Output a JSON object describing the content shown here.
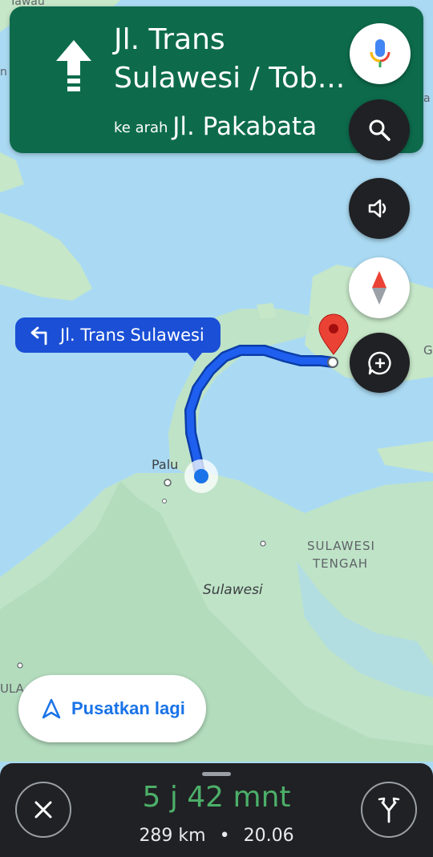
{
  "navigation": {
    "street": "Jl. Trans Sulawesi / Tob...",
    "toward_prefix": "ke arah",
    "toward_street": "Jl. Pakabata"
  },
  "route_label": "Jl. Trans Sulawesi",
  "map_labels": {
    "top_left": "Tawau",
    "city": "Palu",
    "region_line1": "SULAWESI",
    "region_line2": "TENGAH",
    "island": "Sulawesi",
    "edge_left": "ULA",
    "edge_right": "G",
    "edge_left_top": "n",
    "edge_right_top": "a"
  },
  "recenter_label": "Pusatkan lagi",
  "trip": {
    "duration": "5 j 42 mnt",
    "distance": "289 km",
    "separator": "•",
    "arrival": "20.06"
  },
  "icons": {
    "mic": "mic-icon",
    "search": "search-icon",
    "sound": "volume-icon",
    "compass": "compass-icon",
    "add_report": "add-report-icon",
    "turn_left": "turn-left-icon",
    "navigate": "navigation-arrow-icon",
    "close": "close-icon",
    "alt_routes": "alternate-routes-icon"
  },
  "colors": {
    "header_bg": "#0d6b4c",
    "route": "#1a4fd6",
    "eta": "#4caf69",
    "water": "#aadaf3",
    "land": "#bfe3c7"
  }
}
